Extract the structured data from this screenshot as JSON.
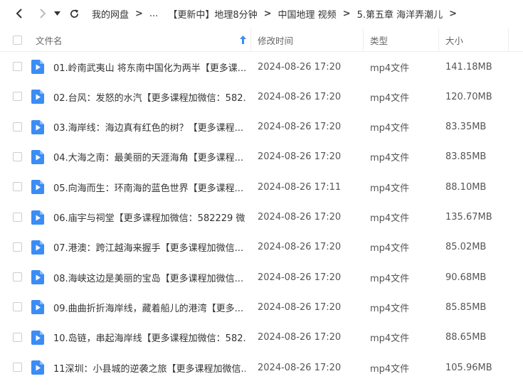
{
  "nav": {
    "breadcrumb": [
      "我的网盘",
      "...",
      "【更新中】地理8分钟",
      "中国地理 视频",
      "5.第五章 海洋弄潮儿"
    ]
  },
  "columns": {
    "name": "文件名",
    "modified": "修改时间",
    "type": "类型",
    "size": "大小"
  },
  "colors": {
    "icon_blue": "#3b8cf5",
    "accent": "#3b8cf5"
  },
  "files": [
    {
      "name": "01.岭南武夷山 将东南中国化为两半【更多课...",
      "modified": "2024-08-26 17:20",
      "type": "mp4文件",
      "size": "141.18MB"
    },
    {
      "name": "02.台风：发怒的水汽【更多课程加微信：582...",
      "modified": "2024-08-26 17:20",
      "type": "mp4文件",
      "size": "120.70MB"
    },
    {
      "name": "03.海岸线：海边真有红色的树？【更多课程...",
      "modified": "2024-08-26 17:20",
      "type": "mp4文件",
      "size": "83.35MB"
    },
    {
      "name": "04.大海之南：最美丽的天涯海角【更多课程...",
      "modified": "2024-08-26 17:20",
      "type": "mp4文件",
      "size": "83.85MB"
    },
    {
      "name": "05.向海而生：环南海的蓝色世界【更多课程...",
      "modified": "2024-08-26 17:11",
      "type": "mp4文件",
      "size": "88.10MB"
    },
    {
      "name": "06.庙宇与祠堂【更多课程加微信：582229 微...",
      "modified": "2024-08-26 17:20",
      "type": "mp4文件",
      "size": "135.67MB"
    },
    {
      "name": "07.港澳：跨江越海来握手【更多课程加微信...",
      "modified": "2024-08-26 17:20",
      "type": "mp4文件",
      "size": "85.02MB"
    },
    {
      "name": "08.海峡这边是美丽的宝岛【更多课程加微信...",
      "modified": "2024-08-26 17:20",
      "type": "mp4文件",
      "size": "90.68MB"
    },
    {
      "name": "09.曲曲折折海岸线，藏着船儿的港湾【更多...",
      "modified": "2024-08-26 17:20",
      "type": "mp4文件",
      "size": "85.85MB"
    },
    {
      "name": "10.岛链，串起海岸线【更多课程加微信：582...",
      "modified": "2024-08-26 17:20",
      "type": "mp4文件",
      "size": "88.65MB"
    },
    {
      "name": "11深圳：小县城的逆袭之旅【更多课程加微信...",
      "modified": "2024-08-26 17:20",
      "type": "mp4文件",
      "size": "105.96MB"
    }
  ]
}
